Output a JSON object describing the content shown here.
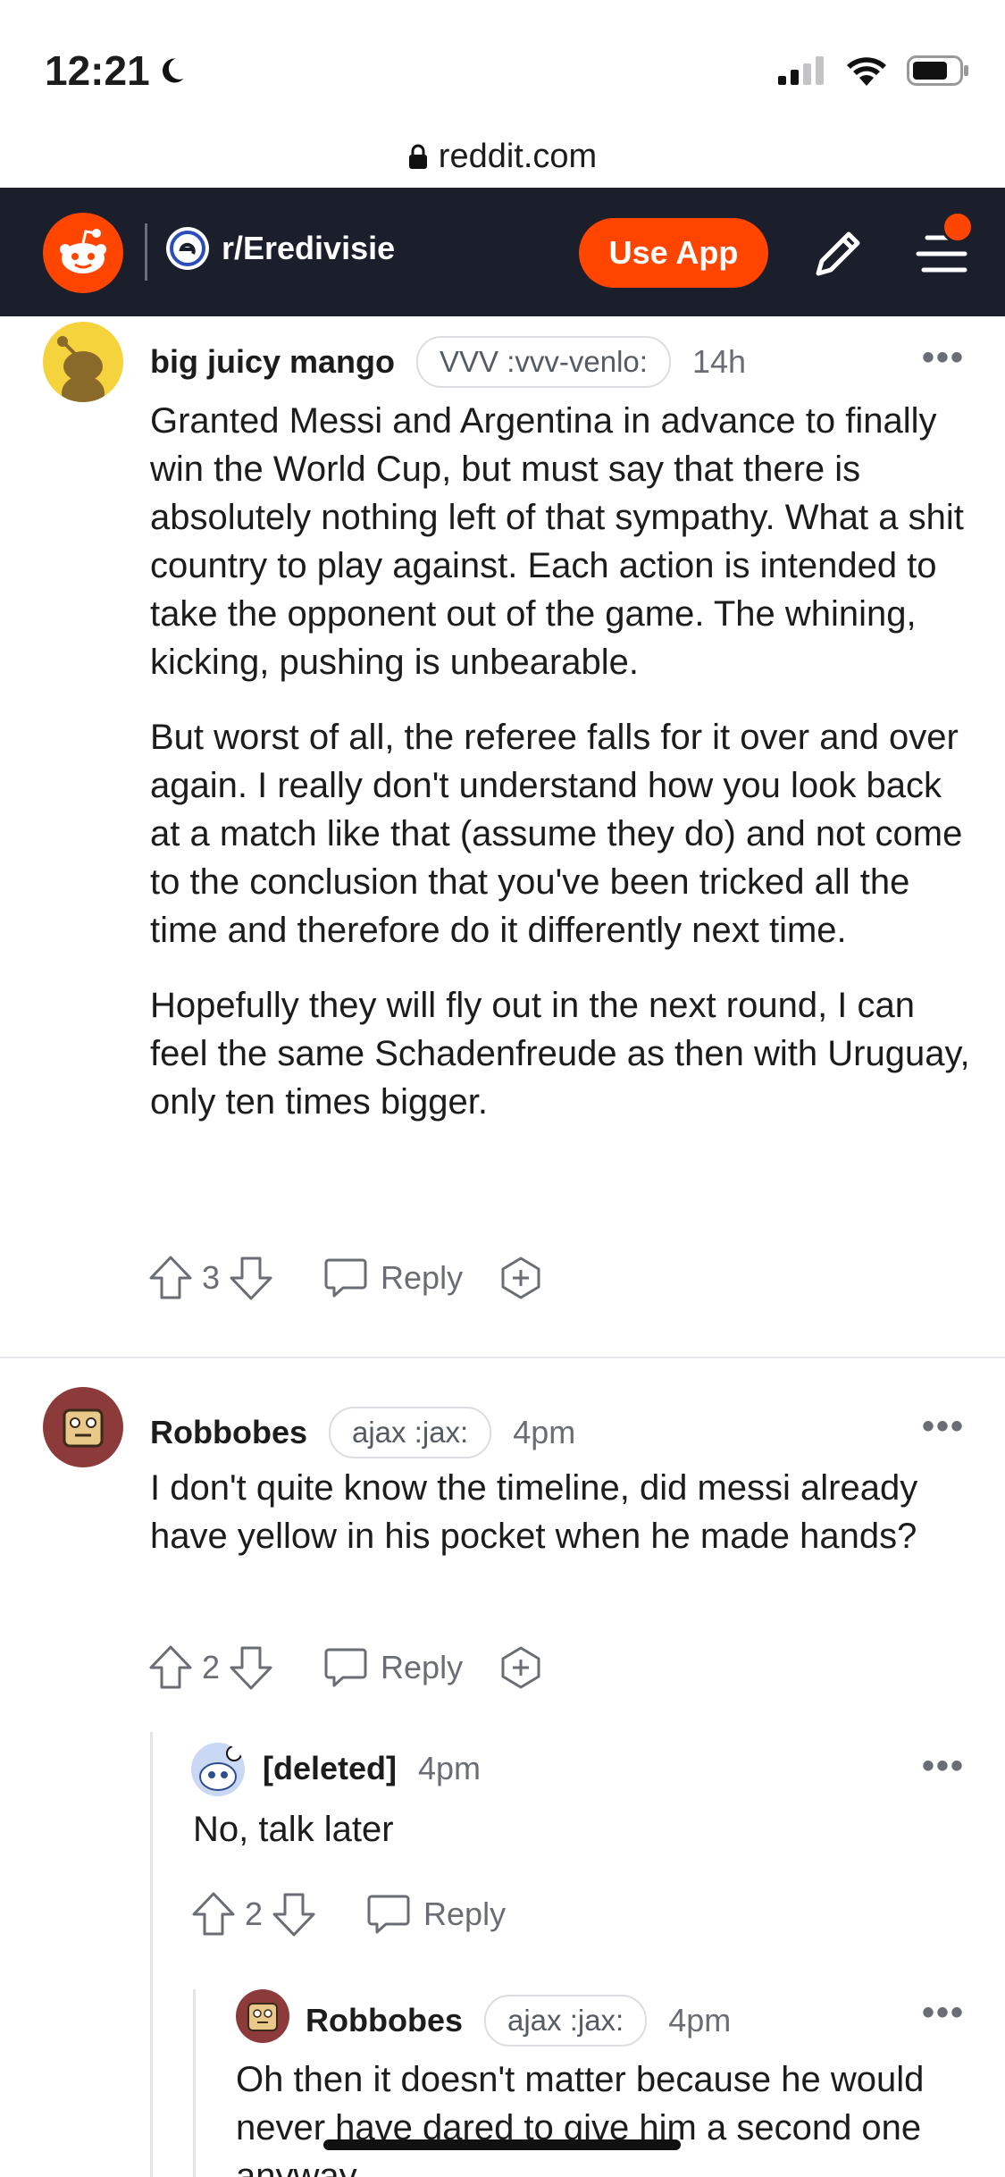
{
  "status": {
    "time": "12:21"
  },
  "browser": {
    "url": "reddit.com"
  },
  "header": {
    "subreddit": "r/Eredivisie",
    "use_app": "Use App"
  },
  "comments": [
    {
      "user": "big juicy mango",
      "flair": "VVV :vvv-venlo:",
      "time": "14h",
      "paragraphs": [
        "Granted Messi and Argentina in advance to finally win the World Cup, but must say that there is absolutely nothing left of that sympathy. What a shit country to play against. Each action is intended to take the opponent out of the game. The whining, kicking, pushing is unbearable.",
        "But worst of all, the referee falls for it over and over again. I really don't understand how you look back at a match like that (assume they do) and not come to the conclusion that you've been tricked all the time and therefore do it differently next time.",
        "Hopefully they will fly out in the next round, I can feel the same Schadenfreude as then with Uruguay, only ten times bigger."
      ],
      "votes": "3",
      "reply": "Reply"
    },
    {
      "user": "Robbobes",
      "flair": "ajax :jax:",
      "time": "4pm",
      "paragraphs": [
        "I don't quite know the timeline, did messi already have yellow in his pocket when he made hands?"
      ],
      "votes": "2",
      "reply": "Reply"
    },
    {
      "user": "[deleted]",
      "time": "4pm",
      "paragraphs": [
        "No, talk later"
      ],
      "votes": "2",
      "reply": "Reply"
    },
    {
      "user": "Robbobes",
      "flair": "ajax :jax:",
      "time": "4pm",
      "paragraphs": [
        "Oh then it doesn't matter because he would never have dared to give him a second one anyway"
      ]
    }
  ],
  "colors": {
    "brand": "#ff4500",
    "header_bg": "#1a1f2b"
  }
}
